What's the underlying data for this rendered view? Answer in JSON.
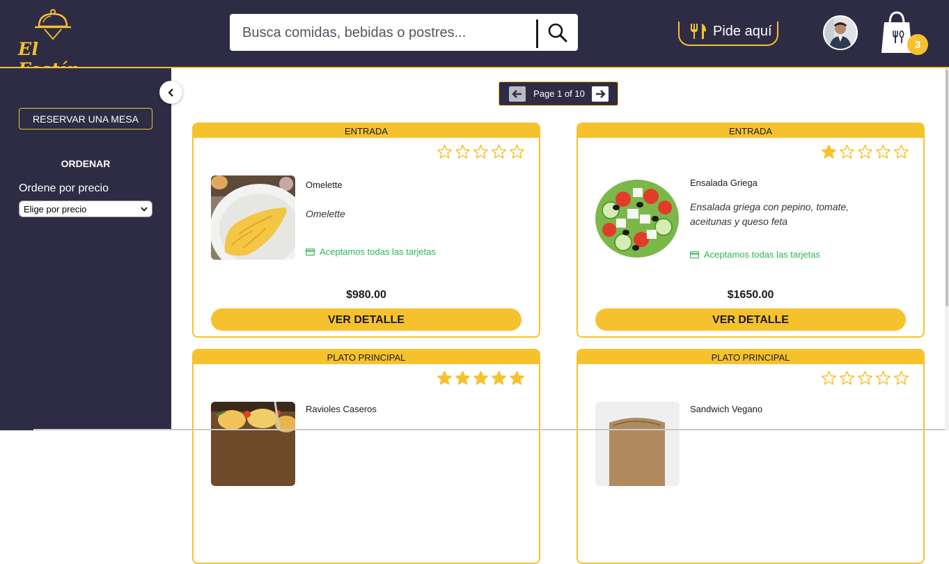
{
  "brand": {
    "name": "El Festín",
    "accent": "#f5c22e",
    "dark": "#2e2c45",
    "green": "#2eb550"
  },
  "search": {
    "placeholder": "Busca comidas, bebidas o postres..."
  },
  "header": {
    "order_label": "Pide aquí",
    "cart_count": "3"
  },
  "sidebar": {
    "reserve_label": "RESERVAR UNA MESA",
    "sort_title": "ORDENAR",
    "sort_label": "Ordene por precio",
    "sort_value": "Elige por precio"
  },
  "pager": {
    "text": "Page 1 of 10",
    "current_page": 1,
    "total_pages": 10
  },
  "products": [
    {
      "category": "ENTRADA",
      "name": "Omelette",
      "description": "Omelette",
      "payment": "Aceptamos todas las tarjetas",
      "price": "$980.00",
      "button": "VER DETALLE",
      "rating": 0
    },
    {
      "category": "ENTRADA",
      "name": "Ensalada Griega",
      "description": "Ensalada griega con pepino, tomate, aceitunas y queso feta",
      "payment": "Aceptamos todas las tarjetas",
      "price": "$1650.00",
      "button": "VER DETALLE",
      "rating": 1
    },
    {
      "category": "PLATO PRINCIPAL",
      "name": "Ravioles Caseros",
      "rating": 5
    },
    {
      "category": "PLATO PRINCIPAL",
      "name": "Sandwich Vegano",
      "rating": 0
    }
  ]
}
